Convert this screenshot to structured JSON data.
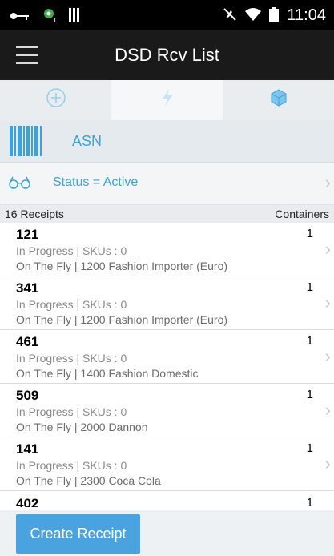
{
  "status_bar": {
    "time": "11:04",
    "icons": [
      "key-icon",
      "notification-icon",
      "sim-icon",
      "no-sound-icon",
      "wifi-icon",
      "battery-icon"
    ]
  },
  "app_bar": {
    "title": "DSD Rcv List",
    "menu_icon": "hamburger-icon"
  },
  "tabs": [
    {
      "icon": "add-circle-icon",
      "active": false
    },
    {
      "icon": "lightning-icon",
      "active": true
    },
    {
      "icon": "cube-icon",
      "active": false
    }
  ],
  "scan": {
    "icon": "barcode-icon",
    "label": "ASN"
  },
  "filter": {
    "icon": "glasses-icon",
    "label": "Status = Active"
  },
  "list_header": {
    "left": "16 Receipts",
    "right": "Containers"
  },
  "receipts": [
    {
      "id": "121",
      "count": "1",
      "line2": "In Progress  |  SKUs : 0",
      "line3": "On The Fly  |  1200 Fashion Importer (Euro)"
    },
    {
      "id": "341",
      "count": "1",
      "line2": "In Progress  |  SKUs : 0",
      "line3": "On The Fly  |  1200 Fashion Importer (Euro)"
    },
    {
      "id": "461",
      "count": "1",
      "line2": "In Progress  |  SKUs : 0",
      "line3": "On The Fly  |  1400 Fashion Domestic"
    },
    {
      "id": "509",
      "count": "1",
      "line2": "In Progress  |  SKUs : 0",
      "line3": "On The Fly  |  2000 Dannon"
    },
    {
      "id": "141",
      "count": "1",
      "line2": "In Progress  |  SKUs : 0",
      "line3": "On The Fly  |  2300 Coca Cola"
    },
    {
      "id": "402",
      "count": "1",
      "line2": "",
      "line3": ""
    }
  ],
  "footer": {
    "create_label": "Create Receipt"
  },
  "colors": {
    "accent": "#4aa3df",
    "link": "#3aa3dc",
    "appbar": "#1a1a1a"
  }
}
